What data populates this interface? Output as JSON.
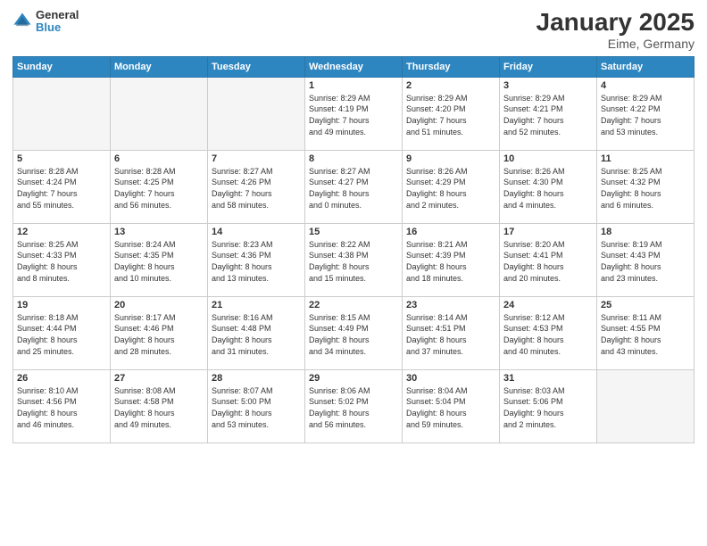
{
  "logo": {
    "line1": "General",
    "line2": "Blue"
  },
  "title": "January 2025",
  "subtitle": "Eime, Germany",
  "days_header": [
    "Sunday",
    "Monday",
    "Tuesday",
    "Wednesday",
    "Thursday",
    "Friday",
    "Saturday"
  ],
  "weeks": [
    [
      {
        "day": "",
        "info": ""
      },
      {
        "day": "",
        "info": ""
      },
      {
        "day": "",
        "info": ""
      },
      {
        "day": "1",
        "info": "Sunrise: 8:29 AM\nSunset: 4:19 PM\nDaylight: 7 hours\nand 49 minutes."
      },
      {
        "day": "2",
        "info": "Sunrise: 8:29 AM\nSunset: 4:20 PM\nDaylight: 7 hours\nand 51 minutes."
      },
      {
        "day": "3",
        "info": "Sunrise: 8:29 AM\nSunset: 4:21 PM\nDaylight: 7 hours\nand 52 minutes."
      },
      {
        "day": "4",
        "info": "Sunrise: 8:29 AM\nSunset: 4:22 PM\nDaylight: 7 hours\nand 53 minutes."
      }
    ],
    [
      {
        "day": "5",
        "info": "Sunrise: 8:28 AM\nSunset: 4:24 PM\nDaylight: 7 hours\nand 55 minutes."
      },
      {
        "day": "6",
        "info": "Sunrise: 8:28 AM\nSunset: 4:25 PM\nDaylight: 7 hours\nand 56 minutes."
      },
      {
        "day": "7",
        "info": "Sunrise: 8:27 AM\nSunset: 4:26 PM\nDaylight: 7 hours\nand 58 minutes."
      },
      {
        "day": "8",
        "info": "Sunrise: 8:27 AM\nSunset: 4:27 PM\nDaylight: 8 hours\nand 0 minutes."
      },
      {
        "day": "9",
        "info": "Sunrise: 8:26 AM\nSunset: 4:29 PM\nDaylight: 8 hours\nand 2 minutes."
      },
      {
        "day": "10",
        "info": "Sunrise: 8:26 AM\nSunset: 4:30 PM\nDaylight: 8 hours\nand 4 minutes."
      },
      {
        "day": "11",
        "info": "Sunrise: 8:25 AM\nSunset: 4:32 PM\nDaylight: 8 hours\nand 6 minutes."
      }
    ],
    [
      {
        "day": "12",
        "info": "Sunrise: 8:25 AM\nSunset: 4:33 PM\nDaylight: 8 hours\nand 8 minutes."
      },
      {
        "day": "13",
        "info": "Sunrise: 8:24 AM\nSunset: 4:35 PM\nDaylight: 8 hours\nand 10 minutes."
      },
      {
        "day": "14",
        "info": "Sunrise: 8:23 AM\nSunset: 4:36 PM\nDaylight: 8 hours\nand 13 minutes."
      },
      {
        "day": "15",
        "info": "Sunrise: 8:22 AM\nSunset: 4:38 PM\nDaylight: 8 hours\nand 15 minutes."
      },
      {
        "day": "16",
        "info": "Sunrise: 8:21 AM\nSunset: 4:39 PM\nDaylight: 8 hours\nand 18 minutes."
      },
      {
        "day": "17",
        "info": "Sunrise: 8:20 AM\nSunset: 4:41 PM\nDaylight: 8 hours\nand 20 minutes."
      },
      {
        "day": "18",
        "info": "Sunrise: 8:19 AM\nSunset: 4:43 PM\nDaylight: 8 hours\nand 23 minutes."
      }
    ],
    [
      {
        "day": "19",
        "info": "Sunrise: 8:18 AM\nSunset: 4:44 PM\nDaylight: 8 hours\nand 25 minutes."
      },
      {
        "day": "20",
        "info": "Sunrise: 8:17 AM\nSunset: 4:46 PM\nDaylight: 8 hours\nand 28 minutes."
      },
      {
        "day": "21",
        "info": "Sunrise: 8:16 AM\nSunset: 4:48 PM\nDaylight: 8 hours\nand 31 minutes."
      },
      {
        "day": "22",
        "info": "Sunrise: 8:15 AM\nSunset: 4:49 PM\nDaylight: 8 hours\nand 34 minutes."
      },
      {
        "day": "23",
        "info": "Sunrise: 8:14 AM\nSunset: 4:51 PM\nDaylight: 8 hours\nand 37 minutes."
      },
      {
        "day": "24",
        "info": "Sunrise: 8:12 AM\nSunset: 4:53 PM\nDaylight: 8 hours\nand 40 minutes."
      },
      {
        "day": "25",
        "info": "Sunrise: 8:11 AM\nSunset: 4:55 PM\nDaylight: 8 hours\nand 43 minutes."
      }
    ],
    [
      {
        "day": "26",
        "info": "Sunrise: 8:10 AM\nSunset: 4:56 PM\nDaylight: 8 hours\nand 46 minutes."
      },
      {
        "day": "27",
        "info": "Sunrise: 8:08 AM\nSunset: 4:58 PM\nDaylight: 8 hours\nand 49 minutes."
      },
      {
        "day": "28",
        "info": "Sunrise: 8:07 AM\nSunset: 5:00 PM\nDaylight: 8 hours\nand 53 minutes."
      },
      {
        "day": "29",
        "info": "Sunrise: 8:06 AM\nSunset: 5:02 PM\nDaylight: 8 hours\nand 56 minutes."
      },
      {
        "day": "30",
        "info": "Sunrise: 8:04 AM\nSunset: 5:04 PM\nDaylight: 8 hours\nand 59 minutes."
      },
      {
        "day": "31",
        "info": "Sunrise: 8:03 AM\nSunset: 5:06 PM\nDaylight: 9 hours\nand 2 minutes."
      },
      {
        "day": "",
        "info": ""
      }
    ]
  ]
}
